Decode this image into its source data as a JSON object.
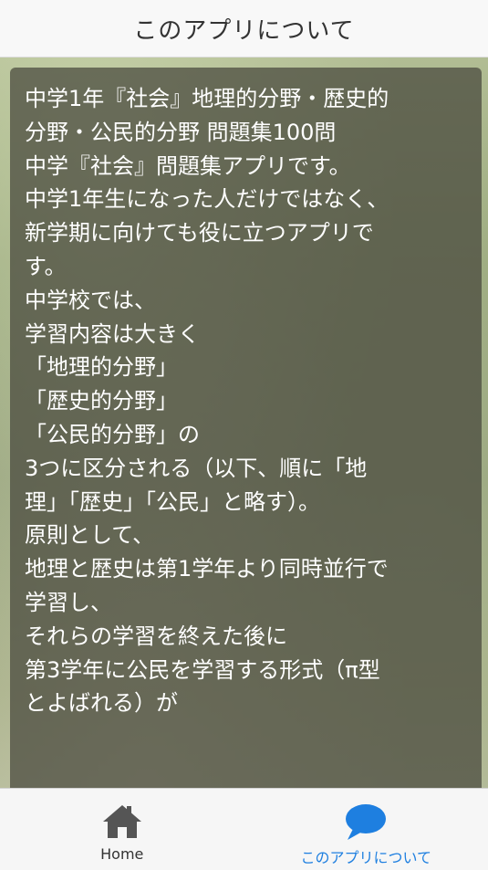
{
  "header": {
    "title": "このアプリについて"
  },
  "content": {
    "lines": [
      "中学1年『社会』地理的分野・歴史的",
      "分野・公民的分野 問題集100問",
      "中学『社会』問題集アプリです。",
      "中学1年生になった人だけではなく、",
      "新学期に向けても役に立つアプリで",
      "す。",
      "中学校では、",
      "学習内容は大きく",
      "「地理的分野」",
      "「歴史的分野」",
      "「公民的分野」の",
      "3つに区分される（以下、順に「地",
      "理」「歴史」「公民」と略す）。",
      "原則として、",
      "地理と歴史は第1学年より同時並行で",
      "学習し、",
      "それらの学習を終えた後に",
      "第3学年に公民を学習する形式（π型",
      "とよばれる）が"
    ]
  },
  "tabbar": {
    "tabs": [
      {
        "label": "Home",
        "icon": "home-icon",
        "active": false
      },
      {
        "label": "このアプリについて",
        "icon": "speech-bubble-icon",
        "active": true
      }
    ]
  },
  "colors": {
    "header_bg": "#f8f8f8",
    "card_bg": "rgba(70,70,60,0.72)",
    "text": "#ffffff",
    "active_tab": "#1e7fe0",
    "inactive_icon": "#555555"
  }
}
